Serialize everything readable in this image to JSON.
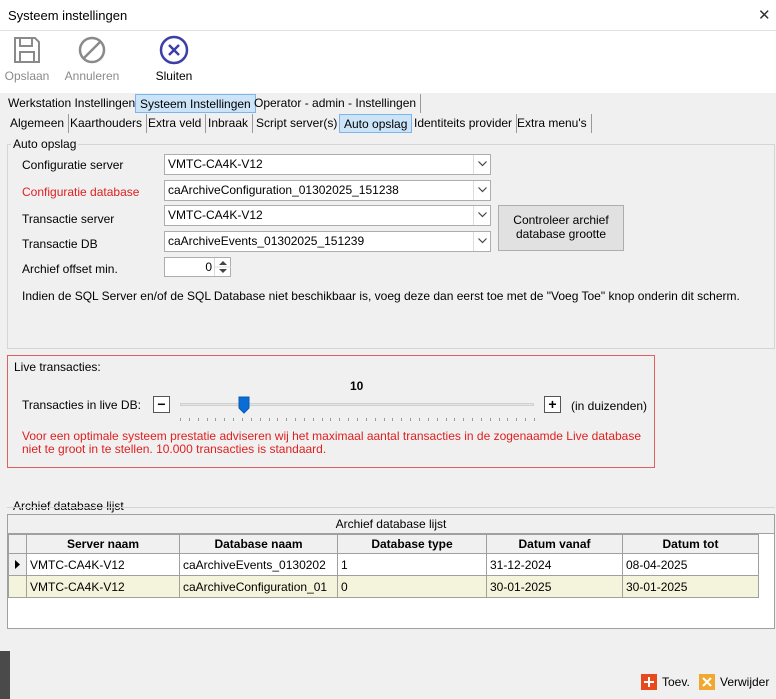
{
  "window": {
    "title": "Systeem instellingen"
  },
  "toolbar": {
    "save_label": "Opslaan",
    "cancel_label": "Annuleren",
    "close_label": "Sluiten"
  },
  "main_tabs": [
    "Werkstation Instellingen",
    "Systeem Instellingen",
    "Operator - admin - Instellingen"
  ],
  "sub_tabs": [
    "Algemeen",
    "Kaarthouders",
    "Extra veld",
    "Inbraak",
    "Script server(s)",
    "Auto opslag",
    "Identiteits provider",
    "Extra menu's"
  ],
  "auto_opslag": {
    "group_title": "Auto opslag",
    "config_server_label": "Configuratie server",
    "config_server_value": "VMTC-CA4K-V12",
    "config_db_label": "Configuratie database",
    "config_db_value": "caArchiveConfiguration_01302025_151238",
    "trans_server_label": "Transactie server",
    "trans_server_value": "VMTC-CA4K-V12",
    "trans_db_label": "Transactie DB",
    "trans_db_value": "caArchiveEvents_01302025_151239",
    "offset_label": "Archief offset min.",
    "offset_value": "0",
    "check_button": "Controleer archief database grootte",
    "info_text": "Indien de SQL Server en/of de SQL Database niet beschikbaar is, voeg deze dan eerst toe met de \"Voeg Toe\" knop onderin dit scherm.",
    "label_color": "#e02020"
  },
  "live": {
    "group_title": "Live transacties:",
    "slider_label": "Transacties in live DB:",
    "slider_value": "10",
    "slider_fraction": 0.18,
    "unit": "(in duizenden)",
    "minus": "−",
    "plus": "+",
    "warning": "Voor een optimale systeem prestatie adviseren wij het maximaal aantal transacties in de zogenaamde Live database niet te groot in te stellen. 10.000 transacties is standaard.",
    "warning_color": "#e02020"
  },
  "archive": {
    "group_title": "Archief database lijst",
    "caption": "Archief database lijst",
    "columns": [
      "Server naam",
      "Database naam",
      "Database type",
      "Datum vanaf",
      "Datum tot"
    ],
    "rows": [
      [
        "VMTC-CA4K-V12",
        "caArchiveEvents_0130202",
        "1",
        "31-12-2024",
        "08-04-2025"
      ],
      [
        "VMTC-CA4K-V12",
        "caArchiveConfiguration_01",
        "0",
        "30-01-2025",
        "30-01-2025"
      ]
    ]
  },
  "footer": {
    "add_label": "Toev.",
    "remove_label": "Verwijder"
  }
}
